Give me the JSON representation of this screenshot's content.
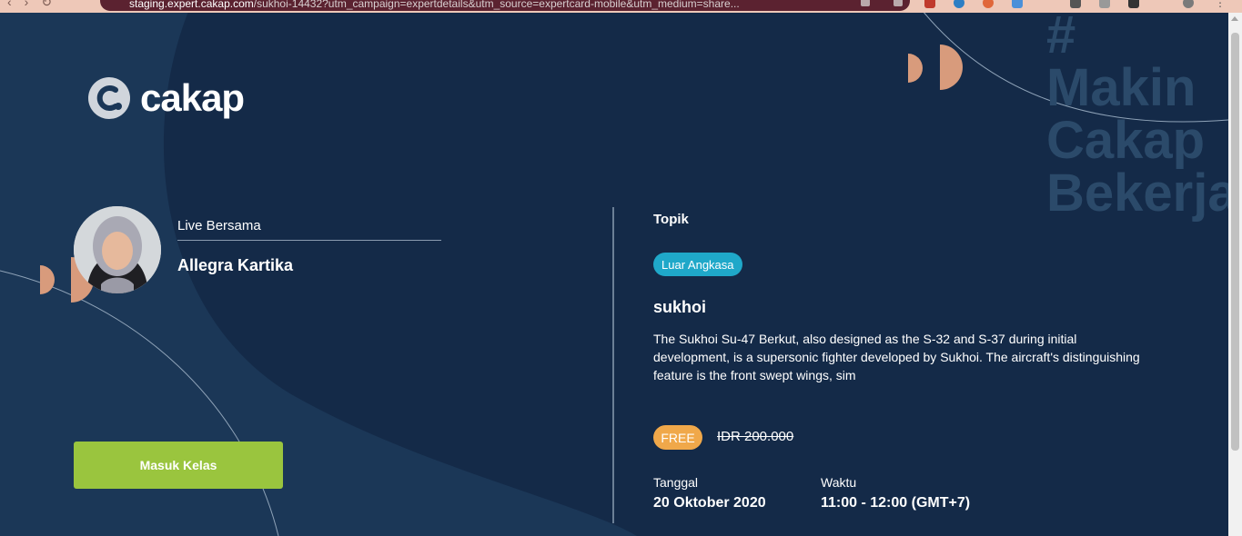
{
  "browser": {
    "url_host": "staging.expert.cakap.com",
    "url_path": "/sukhoi-14432?utm_campaign=expertdetails&utm_source=expertcard-mobile&utm_medium=share..."
  },
  "brand": {
    "logo_text": "cakap",
    "hashtag_lines": [
      "#",
      "Makin",
      "Cakap",
      "Bekerja"
    ]
  },
  "expert": {
    "live_label": "Live Bersama",
    "name": "Allegra Kartika"
  },
  "cta": {
    "join_label": "Masuk Kelas"
  },
  "session": {
    "topic_label": "Topik",
    "topic_chip": "Luar Angkasa",
    "title": "sukhoi",
    "description": "The Sukhoi Su-47 Berkut, also designed as the S-32 and S-37 during initial development, is a supersonic fighter developed by Sukhoi. The aircraft's distinguishing feature is the front swept wings, sim",
    "price_badge": "FREE",
    "original_price": "IDR 200.000",
    "date_label": "Tanggal",
    "date_value": "20 Oktober 2020",
    "time_label": "Waktu",
    "time_value": "11:00 - 12:00 (GMT+7)"
  },
  "colors": {
    "background": "#1b3757",
    "background_dark": "#142a48",
    "accent_green": "#9ac53e",
    "accent_orange": "#f0a84a",
    "chip_blue": "#1fa8c9",
    "peach_decor": "#d89b7c"
  }
}
